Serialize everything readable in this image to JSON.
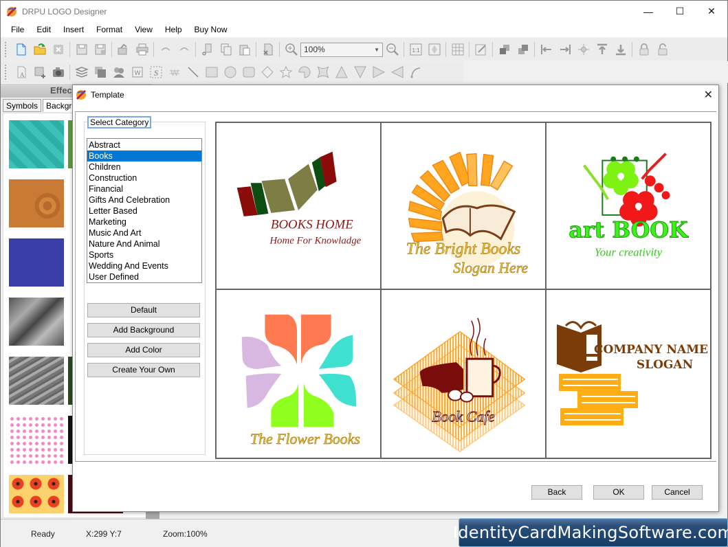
{
  "window": {
    "title": "DRPU LOGO Designer",
    "controls": {
      "minimize": "—",
      "maximize": "☐",
      "close": "✕"
    }
  },
  "menubar": {
    "items": [
      "File",
      "Edit",
      "Insert",
      "Format",
      "View",
      "Help",
      "Buy Now"
    ]
  },
  "toolbar": {
    "zoom_value": "100%",
    "row1_icons": [
      "new-file-icon",
      "open-folder-icon",
      "close-file-icon",
      "save-icon",
      "save-as-icon",
      "export-icon",
      "print-icon",
      "undo-icon",
      "redo-icon",
      "cut-icon",
      "copy-icon",
      "paste-icon",
      "delete-icon",
      "zoom-in-icon",
      "zoom-out-icon",
      "actual-size-icon",
      "fit-to-window-icon",
      "grid-icon",
      "edit-properties-icon",
      "bring-forward-icon",
      "send-backward-icon",
      "align-left-icon",
      "align-right-icon",
      "align-center-icon",
      "align-top-icon",
      "align-bottom-icon",
      "lock-icon",
      "unlock-icon"
    ],
    "row2_icons": [
      "text-icon",
      "image-icon",
      "camera-icon",
      "layers-icon",
      "shadow-icon",
      "clipart-icon",
      "wordart-icon",
      "signature-icon",
      "watermark-icon",
      "line-icon",
      "rectangle-icon",
      "ellipse-icon",
      "rounded-rectangle-icon",
      "diamond-icon",
      "star-icon",
      "pie-icon",
      "cross-icon",
      "triangle-up-icon",
      "triangle-down-icon",
      "triangle-right-icon",
      "triangle-left-icon",
      "arc-icon"
    ]
  },
  "left_panel": {
    "header": "Effects",
    "tabs": [
      "Symbols",
      "Backgrounds"
    ],
    "active_tab": "Backgrounds"
  },
  "dialog": {
    "title": "Template",
    "close": "✕",
    "group_label": "Select Category",
    "categories": [
      "Abstract",
      "Books",
      "Children",
      "Construction",
      "Financial",
      "Gifts And Celebration",
      "Letter Based",
      "Marketing",
      "Music And Art",
      "Nature And Animal",
      "Sports",
      "Wedding And Events",
      "User Defined"
    ],
    "selected_category": "Books",
    "side_buttons": [
      "Default",
      "Add Background",
      "Add Color",
      "Create Your Own"
    ],
    "templates": [
      {
        "title": "BOOKS HOME",
        "slogan": "Home For Knowladge"
      },
      {
        "title": "The Bright Books",
        "slogan": "Slogan Here"
      },
      {
        "title": "art BOOK",
        "slogan": "Your creativity"
      },
      {
        "title": "The Flower Books",
        "slogan": ""
      },
      {
        "title": "Book Cafe",
        "slogan": ""
      },
      {
        "title": "COMPANY NAME",
        "slogan": "SLOGAN"
      }
    ],
    "footer_buttons": {
      "back": "Back",
      "ok": "OK",
      "cancel": "Cancel"
    }
  },
  "statusbar": {
    "status": "Ready",
    "coords": "X:299  Y:7",
    "zoom": "Zoom:100%"
  },
  "branding": "IdentityCardMakingSoftware.com"
}
